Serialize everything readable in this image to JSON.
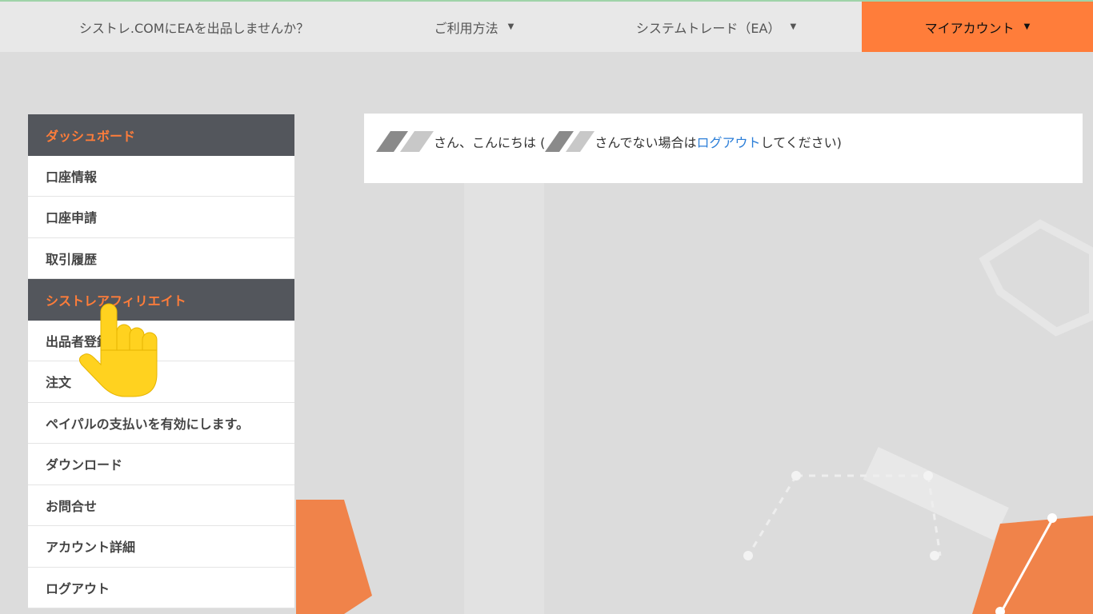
{
  "topnav": {
    "sell_label": "シストレ.COMにEAを出品しませんか？",
    "usage_label": "ご利用方法",
    "system_label": "システムトレード（EA）",
    "account_label": "マイアカウント",
    "caret": "▼",
    "accent_color": "#ff7d3a"
  },
  "sidebar": {
    "items": [
      {
        "label": "ダッシュボード",
        "type": "header"
      },
      {
        "label": "口座情報"
      },
      {
        "label": "口座申請"
      },
      {
        "label": "取引履歴"
      },
      {
        "label": "シストレアフィリエイト",
        "type": "header"
      },
      {
        "label": "出品者登録"
      },
      {
        "label": "注文"
      },
      {
        "label": "ペイパルの支払いを有効にします。"
      },
      {
        "label": "ダウンロード"
      },
      {
        "label": "お問合せ"
      },
      {
        "label": "アカウント詳細"
      },
      {
        "label": "ログアウト"
      }
    ]
  },
  "main": {
    "greeting_part1": "さん、こんにちは (",
    "greeting_part2": "さんでない場合は",
    "logout_link": "ログアウト",
    "greeting_part3": "してください)"
  },
  "cursor": {
    "icon": "pointing-hand-icon",
    "color": "#ffd21f"
  }
}
